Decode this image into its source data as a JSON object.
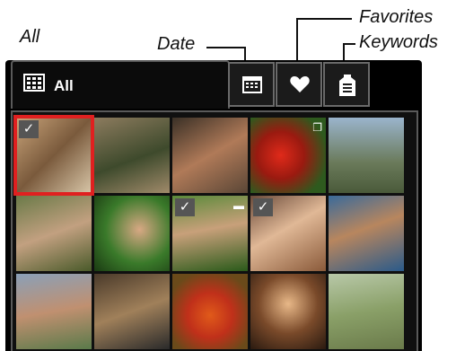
{
  "callouts": {
    "all": "All",
    "date": "Date",
    "favorites": "Favorites",
    "keywords": "Keywords"
  },
  "tabs": {
    "all_label": "All",
    "date_icon": "calendar-icon",
    "favorites_icon": "heart-icon",
    "keywords_icon": "tag-icon"
  },
  "thumbnails": [
    {
      "row": 0,
      "col": 0,
      "selected": true,
      "checked": true,
      "badge": ""
    },
    {
      "row": 0,
      "col": 1,
      "selected": false,
      "checked": false,
      "badge": ""
    },
    {
      "row": 0,
      "col": 2,
      "selected": false,
      "checked": false,
      "badge": ""
    },
    {
      "row": 0,
      "col": 3,
      "selected": false,
      "checked": false,
      "badge": "multi"
    },
    {
      "row": 0,
      "col": 4,
      "selected": false,
      "checked": false,
      "badge": ""
    },
    {
      "row": 1,
      "col": 0,
      "selected": false,
      "checked": false,
      "badge": ""
    },
    {
      "row": 1,
      "col": 1,
      "selected": false,
      "checked": false,
      "badge": ""
    },
    {
      "row": 1,
      "col": 2,
      "selected": false,
      "checked": true,
      "badge": "folder"
    },
    {
      "row": 1,
      "col": 3,
      "selected": false,
      "checked": true,
      "badge": ""
    },
    {
      "row": 1,
      "col": 4,
      "selected": false,
      "checked": false,
      "badge": ""
    },
    {
      "row": 2,
      "col": 0,
      "selected": false,
      "checked": false,
      "badge": ""
    },
    {
      "row": 2,
      "col": 1,
      "selected": false,
      "checked": false,
      "badge": ""
    },
    {
      "row": 2,
      "col": 2,
      "selected": false,
      "checked": false,
      "badge": ""
    },
    {
      "row": 2,
      "col": 3,
      "selected": false,
      "checked": false,
      "badge": ""
    },
    {
      "row": 2,
      "col": 4,
      "selected": false,
      "checked": false,
      "badge": ""
    }
  ],
  "colors": {
    "selection": "#e02020",
    "background": "#000000"
  }
}
